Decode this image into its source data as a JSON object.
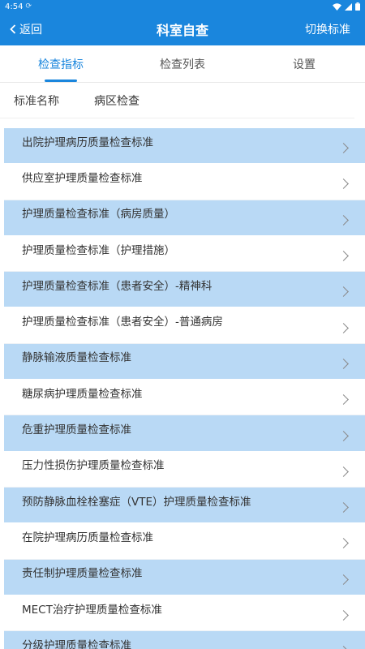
{
  "status_bar": {
    "time": "4:54"
  },
  "nav": {
    "back_label": "返回",
    "title": "科室自查",
    "action_label": "切换标准"
  },
  "tabs": [
    {
      "label": "检查指标",
      "active": true
    },
    {
      "label": "检查列表",
      "active": false
    },
    {
      "label": "设置",
      "active": false
    }
  ],
  "filter": {
    "label": "标准名称",
    "value": "病区检查"
  },
  "items": [
    {
      "label": "出院护理病历质量检查标准"
    },
    {
      "label": "供应室护理质量检查标准"
    },
    {
      "label": "护理质量检查标准（病房质量）"
    },
    {
      "label": "护理质量检查标准（护理措施）"
    },
    {
      "label": "护理质量检查标准（患者安全）-精神科"
    },
    {
      "label": "护理质量检查标准（患者安全）-普通病房"
    },
    {
      "label": "静脉输液质量检查标准"
    },
    {
      "label": "糖尿病护理质量检查标准"
    },
    {
      "label": "危重护理质量检查标准"
    },
    {
      "label": "压力性损伤护理质量检查标准"
    },
    {
      "label": "预防静脉血栓栓塞症（VTE）护理质量检查标准"
    },
    {
      "label": "在院护理病历质量检查标准"
    },
    {
      "label": "责任制护理质量检查标准"
    },
    {
      "label": "MECT治疗护理质量检查标准"
    },
    {
      "label": "分级护理质量检查标准"
    }
  ],
  "colors": {
    "primary": "#1a86dd",
    "row_highlight": "#b9d9f5"
  }
}
